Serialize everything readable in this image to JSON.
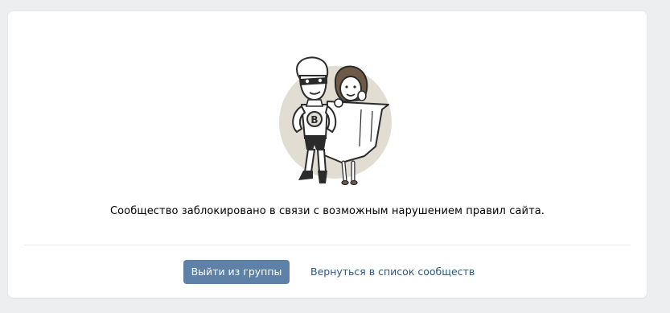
{
  "colors": {
    "background": "#edeef0",
    "card": "#ffffff",
    "button_bg": "#5e81a8",
    "button_text": "#ffffff",
    "link": "#2a5885",
    "divider": "#e7e8ec"
  },
  "illustration": {
    "icon": "blocked-community-superheroes-icon"
  },
  "message": "Сообщество заблокировано в связи с возможным нарушением правил сайта.",
  "actions": {
    "leave_group_label": "Выйти из группы",
    "back_to_list_label": "Вернуться в список сообществ"
  }
}
